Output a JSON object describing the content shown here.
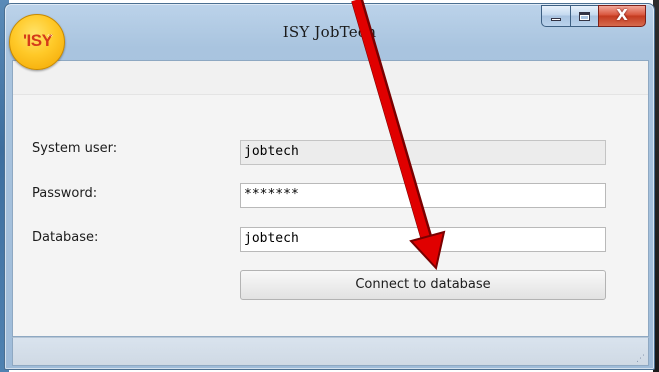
{
  "window": {
    "title": "ISY JobTech",
    "logo_text": "'ISY",
    "logo_dots": "°°"
  },
  "caption": {
    "close_symbol": "X"
  },
  "form": {
    "system_user_label": "System user:",
    "system_user_value": "jobtech",
    "password_label": "Password:",
    "password_value": "*******",
    "database_label": "Database:",
    "database_value": "jobtech",
    "connect_label": "Connect to database"
  },
  "status": {
    "grip": "⋰"
  },
  "colors": {
    "annotation_arrow": "#e00000",
    "close_button": "#c43a1f",
    "logo": "#ffc928"
  }
}
